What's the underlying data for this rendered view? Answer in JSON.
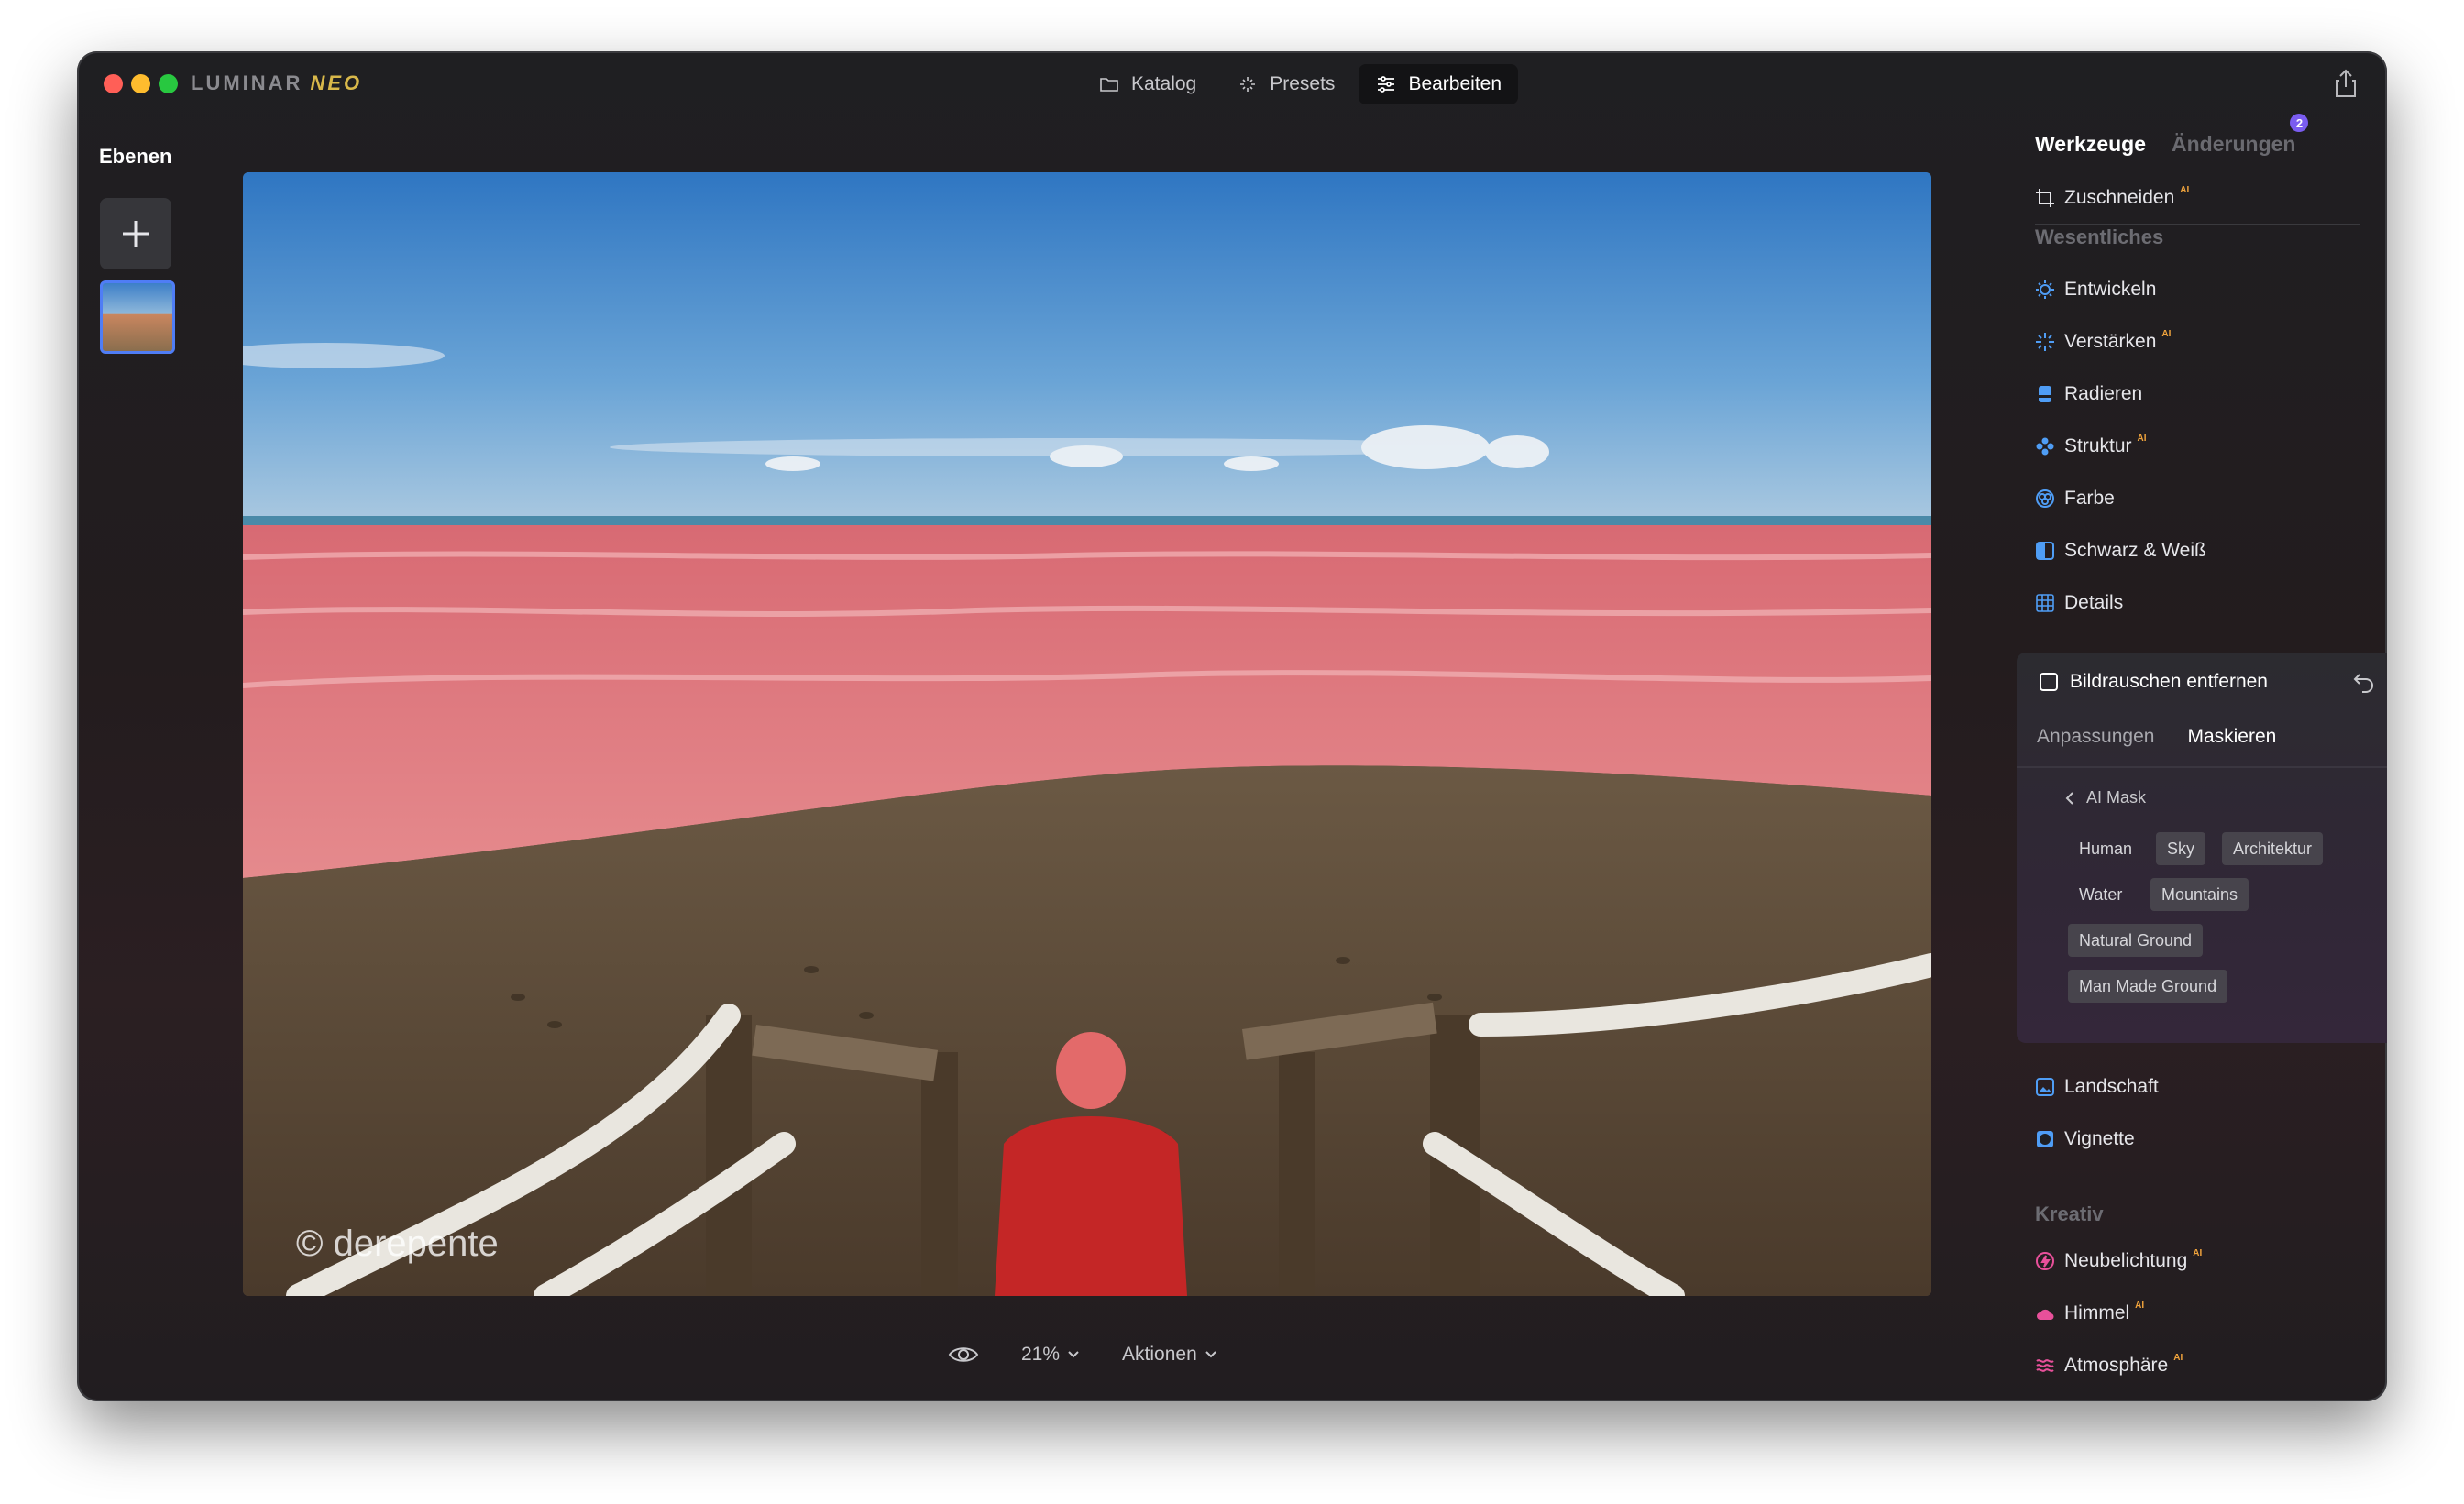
{
  "app": {
    "logo_main": "LUMINAR",
    "logo_neo": "NEO"
  },
  "topnav": {
    "katalog": "Katalog",
    "presets": "Presets",
    "bearbeiten": "Bearbeiten"
  },
  "layers": {
    "title": "Ebenen"
  },
  "photo": {
    "watermark": "© derepente"
  },
  "bottombar": {
    "zoom": "21%",
    "actions": "Aktionen"
  },
  "panel": {
    "tab_tools": "Werkzeuge",
    "tab_changes": "Änderungen",
    "changes_count": "2",
    "ai_badge": "AI",
    "crop": "Zuschneiden",
    "section_essentials": "Wesentliches",
    "develop": "Entwickeln",
    "enhance": "Verstärken",
    "erase": "Radieren",
    "structure": "Struktur",
    "color": "Farbe",
    "bw": "Schwarz & Weiß",
    "details": "Details",
    "active_tool": "Bildrauschen entfernen",
    "subtab_adjust": "Anpassungen",
    "subtab_mask": "Maskieren",
    "ai_mask": "AI Mask",
    "chips": {
      "human": "Human",
      "sky": "Sky",
      "architecture": "Architektur",
      "water": "Water",
      "mountains": "Mountains",
      "natural_ground": "Natural Ground",
      "man_made_ground": "Man Made Ground"
    },
    "landscape": "Landschaft",
    "vignette": "Vignette",
    "section_creative": "Kreativ",
    "relight": "Neubelichtung",
    "sky": "Himmel",
    "atmosphere": "Atmosphäre"
  },
  "colors": {
    "accent_blue": "#4f7df5",
    "ai_badge": "#f1a43c",
    "mask_red": "#e84a5f"
  }
}
